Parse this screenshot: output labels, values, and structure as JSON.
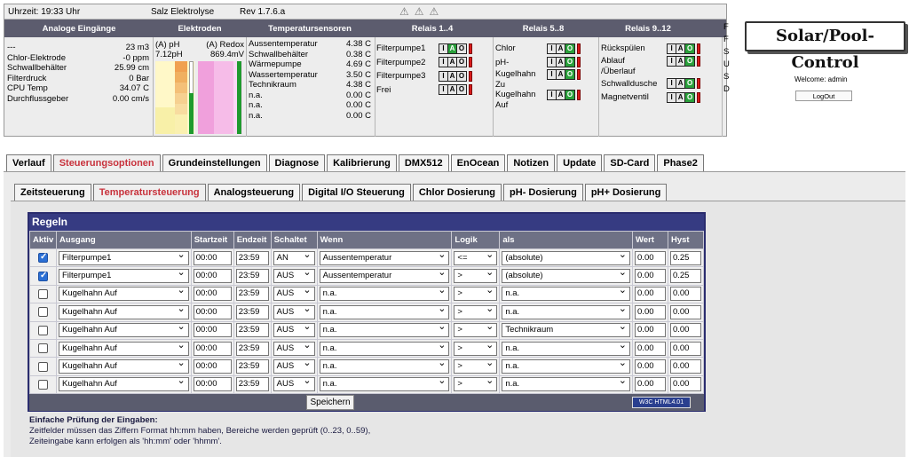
{
  "topbar": {
    "time": "Uhrzeit: 19:33 Uhr",
    "name": "Salz Elektrolyse",
    "rev": "Rev 1.7.6.a"
  },
  "headers": [
    "Analoge Eingänge",
    "Elektroden",
    "Temperatursensoren",
    "Relais 1..4",
    "Relais 5..8",
    "Relais 9..12"
  ],
  "analog": [
    {
      "k": "---",
      "v": "23 m3"
    },
    {
      "k": "Chlor-Elektrode",
      "v": "-0 ppm"
    },
    {
      "k": "Schwallbehälter",
      "v": "25.99 cm"
    },
    {
      "k": "Filterdruck",
      "v": "0 Bar"
    },
    {
      "k": "CPU Temp",
      "v": "34.07 C"
    },
    {
      "k": "Durchflussgeber",
      "v": "0.00 cm/s"
    }
  ],
  "electrodes": {
    "ph_label": "(A) pH",
    "ph_value": "7.12pH",
    "redox_label": "(A) Redox",
    "redox_value": "869.4mV"
  },
  "temps": [
    {
      "k": "Aussentemperatur",
      "v": "4.38 C"
    },
    {
      "k": "Schwallbehälter",
      "v": "0.38 C"
    },
    {
      "k": "Wärmepumpe",
      "v": "4.69 C"
    },
    {
      "k": "Wassertemperatur",
      "v": "3.50 C"
    },
    {
      "k": "Technikraum",
      "v": "4.38 C"
    },
    {
      "k": "n.a.",
      "v": "0.00 C"
    },
    {
      "k": "n.a.",
      "v": "0.00 C"
    },
    {
      "k": "n.a.",
      "v": "0.00 C"
    }
  ],
  "relays1": [
    "Filterpumpe1",
    "Filterpumpe2",
    "Filterpumpe3",
    "Frei"
  ],
  "relays2": [
    "Chlor",
    "pH-",
    "Kugelhahn",
    "Zu",
    "Kugelhahn",
    "Auf"
  ],
  "relays3": [
    "Rückspülen",
    "Ablauf",
    "/Überlauf",
    "Schwalldusche",
    "Magnetventil"
  ],
  "relays4": [
    "F",
    "F",
    "S",
    "U",
    "S",
    "D"
  ],
  "iao": [
    "I",
    "A",
    "O"
  ],
  "brand": "Solar/Pool-Control",
  "welcome": "Welcome: admin",
  "logout": "LogOut",
  "main_tabs": [
    "Verlauf",
    "Steuerungsoptionen",
    "Grundeinstellungen",
    "Diagnose",
    "Kalibrierung",
    "DMX512",
    "EnOcean",
    "Notizen",
    "Update",
    "SD-Card",
    "Phase2"
  ],
  "sub_tabs": [
    "Zeitsteuerung",
    "Temperatursteuerung",
    "Analogsteuerung",
    "Digital I/O Steuerung",
    "Chlor Dosierung",
    "pH- Dosierung",
    "pH+ Dosierung"
  ],
  "rules": {
    "title": "Regeln",
    "columns": [
      "Aktiv",
      "Ausgang",
      "Startzeit",
      "Endzeit",
      "Schaltet",
      "Wenn",
      "Logik",
      "als",
      "Wert",
      "Hyst"
    ],
    "rows": [
      {
        "checked": true,
        "out": "Filterpumpe1",
        "start": "00:00",
        "end": "23:59",
        "sw": "AN",
        "when": "Aussentemperatur",
        "logic": "<=",
        "as": "(absolute)",
        "val": "0.00",
        "hyst": "0.25"
      },
      {
        "checked": true,
        "out": "Filterpumpe1",
        "start": "00:00",
        "end": "23:59",
        "sw": "AUS",
        "when": "Aussentemperatur",
        "logic": ">",
        "as": "(absolute)",
        "val": "0.00",
        "hyst": "0.25"
      },
      {
        "checked": false,
        "out": "Kugelhahn Auf",
        "start": "00:00",
        "end": "23:59",
        "sw": "AUS",
        "when": "n.a.",
        "logic": ">",
        "as": "n.a.",
        "val": "0.00",
        "hyst": "0.00"
      },
      {
        "checked": false,
        "out": "Kugelhahn Auf",
        "start": "00:00",
        "end": "23:59",
        "sw": "AUS",
        "when": "n.a.",
        "logic": ">",
        "as": "n.a.",
        "val": "0.00",
        "hyst": "0.00"
      },
      {
        "checked": false,
        "out": "Kugelhahn Auf",
        "start": "00:00",
        "end": "23:59",
        "sw": "AUS",
        "when": "n.a.",
        "logic": ">",
        "as": "Technikraum",
        "val": "0.00",
        "hyst": "0.00"
      },
      {
        "checked": false,
        "out": "Kugelhahn Auf",
        "start": "00:00",
        "end": "23:59",
        "sw": "AUS",
        "when": "n.a.",
        "logic": ">",
        "as": "n.a.",
        "val": "0.00",
        "hyst": "0.00"
      },
      {
        "checked": false,
        "out": "Kugelhahn Auf",
        "start": "00:00",
        "end": "23:59",
        "sw": "AUS",
        "when": "n.a.",
        "logic": ">",
        "as": "n.a.",
        "val": "0.00",
        "hyst": "0.00"
      },
      {
        "checked": false,
        "out": "Kugelhahn Auf",
        "start": "00:00",
        "end": "23:59",
        "sw": "AUS",
        "when": "n.a.",
        "logic": ">",
        "as": "n.a.",
        "val": "0.00",
        "hyst": "0.00"
      }
    ],
    "save": "Speichern",
    "badge": "W3C HTML4.01"
  },
  "help": {
    "title": "Einfache Prüfung der Eingaben:",
    "line1": "Zeitfelder müssen das Ziffern Format hh:mm haben, Bereiche werden geprüft (0..23, 0..59),",
    "line2": "Zeiteingabe kann erfolgen als 'hh:mm' oder 'hhmm'."
  },
  "colors": {
    "header": "#5c5c6e",
    "rules_title": "#363b82",
    "active_tab": "#c8323c",
    "relay_on": "#2aa03b",
    "relay_led": "#d81a1a"
  }
}
